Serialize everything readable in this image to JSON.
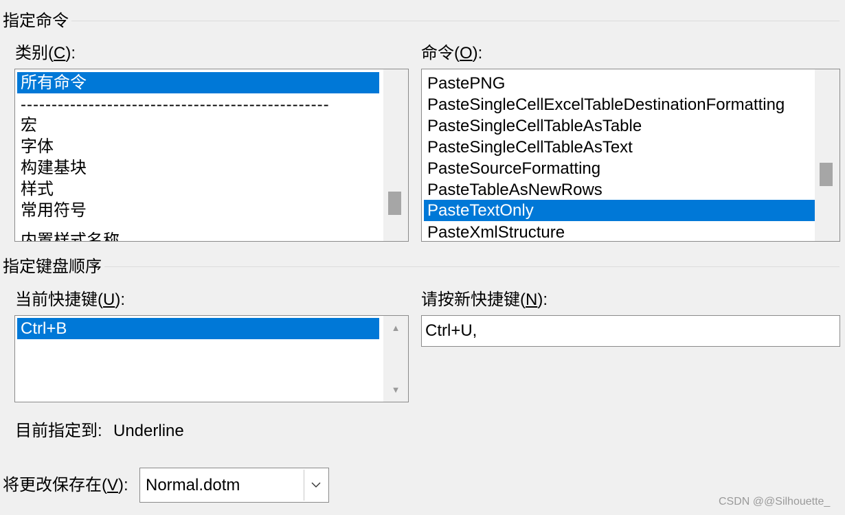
{
  "specify_command": {
    "group_title": "指定命令",
    "categories": {
      "label_prefix": "类别(",
      "accel": "C",
      "label_suffix": "):",
      "items": [
        "所有命令",
        "--------------------------------------------------",
        "宏",
        "字体",
        "构建基块",
        "样式",
        "常用符号",
        "内置样式名称"
      ],
      "selected_index": 0
    },
    "commands": {
      "label_prefix": "命令(",
      "accel": "O",
      "label_suffix": "):",
      "items": [
        "PastePNG",
        "PasteSingleCellExcelTableDestinationFormatting",
        "PasteSingleCellTableAsTable",
        "PasteSingleCellTableAsText",
        "PasteSourceFormatting",
        "PasteTableAsNewRows",
        "PasteTextOnly",
        "PasteXmlStructure"
      ],
      "selected_index": 6
    }
  },
  "keyboard_sequence": {
    "group_title": "指定键盘顺序",
    "current_keys": {
      "label_prefix": "当前快捷键(",
      "accel": "U",
      "label_suffix": "):",
      "items": [
        "Ctrl+B"
      ],
      "selected_index": 0
    },
    "new_key": {
      "label_prefix": "请按新快捷键(",
      "accel": "N",
      "label_suffix": "):",
      "value": "Ctrl+U,"
    },
    "assigned_to": {
      "label": "目前指定到:",
      "value": "Underline"
    }
  },
  "save_in": {
    "label_prefix": "将更改保存在(",
    "accel": "V",
    "label_suffix": "):",
    "value": "Normal.dotm"
  },
  "watermark": "CSDN @@Silhouette_",
  "colors": {
    "selection": "#0078d7",
    "background": "#f0f0f0"
  },
  "icons": {
    "up_arrow": "scroll-up-icon",
    "down_arrow": "scroll-down-icon",
    "combo": "chevron-down-icon"
  }
}
